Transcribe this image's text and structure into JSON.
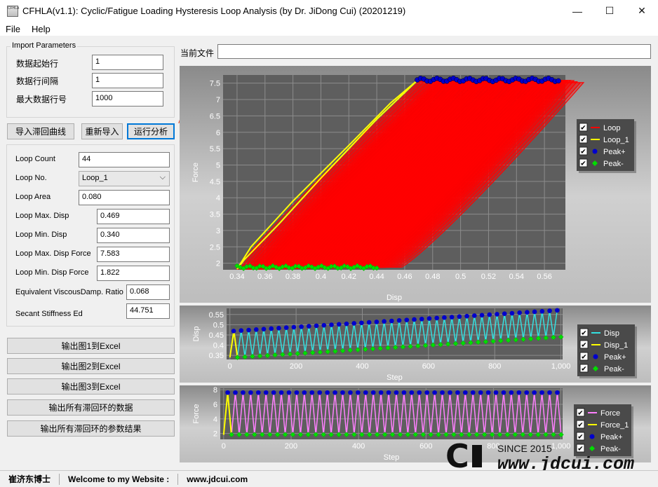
{
  "window": {
    "title": "CFHLA(v1.1): Cyclic/Fatigue Loading Hysteresis Loop Analysis (by Dr. JiDong Cui) (20201219)",
    "icon_label": "CFHLA",
    "minimize_symbol": "—",
    "maximize_symbol": "☐",
    "close_symbol": "✕"
  },
  "menu": {
    "file": "File",
    "help": "Help"
  },
  "import": {
    "legend": "Import Parameters",
    "start_row_label": "数据起始行",
    "start_row_value": "1",
    "row_interval_label": "数据行间隔",
    "row_interval_value": "1",
    "max_row_label": "最大数据行号",
    "max_row_value": "1000"
  },
  "actions": {
    "import_curve": "导入滞回曲线",
    "reimport": "重新导入",
    "run_analysis": "运行分析"
  },
  "results": {
    "loop_count_label": "Loop Count",
    "loop_count_value": "44",
    "loop_no_label": "Loop No.",
    "loop_no_value": "Loop_1",
    "loop_area_label": "Loop Area",
    "loop_area_value": "0.080",
    "max_disp_label": "Loop Max. Disp",
    "max_disp_value": "0.469",
    "min_disp_label": "Loop Min. Disp",
    "min_disp_value": "0.340",
    "max_force_label": "Loop Max. Disp Force",
    "max_force_value": "7.583",
    "min_force_label": "Loop Min. Disp Force",
    "min_force_value": "1.822",
    "damp_label": "Equivalent ViscousDamp. Ratio",
    "damp_value": "0.068",
    "stiff_label": "Secant Stiffness Ed",
    "stiff_value": "44.751"
  },
  "exports": {
    "fig1": "输出图1到Excel",
    "fig2": "输出图2到Excel",
    "fig3": "输出图3到Excel",
    "all_loops": "输出所有滞回环的数据",
    "all_params": "输出所有滞回环的参数结果"
  },
  "current_file": {
    "label": "当前文件",
    "value": ""
  },
  "status": {
    "author": "崔济东博士",
    "welcome": "Welcome to my Website :",
    "site": "www.jdcui.com"
  },
  "watermark": {
    "logo": "C",
    "since": "SINCE 2015",
    "url": "www.jdcui.com"
  },
  "colors": {
    "loop": "#ff0000",
    "loop_1": "#ffff00",
    "peak_plus": "#0000cc",
    "peak_minus": "#00dd00",
    "disp": "#33e0e0",
    "force": "#ff80ff",
    "accent": "#0078d7",
    "arrow": "#e8563a"
  },
  "chart_data": [
    {
      "type": "line",
      "xlabel": "Disp",
      "ylabel": "Force",
      "xticks": [
        "0.34",
        "0.36",
        "0.38",
        "0.4",
        "0.42",
        "0.44",
        "0.46",
        "0.48",
        "0.5",
        "0.52",
        "0.54",
        "0.56"
      ],
      "yticks": [
        "2",
        "2.5",
        "3",
        "3.5",
        "4",
        "4.5",
        "5",
        "5.5",
        "6",
        "6.5",
        "7",
        "7.5"
      ],
      "xlim": [
        0.33,
        0.575
      ],
      "ylim": [
        1.8,
        7.75
      ],
      "legend": [
        "Loop",
        "Loop_1",
        "Peak+",
        "Peak-"
      ],
      "legend_position": "right",
      "series": [
        {
          "name": "Loop",
          "lower_path": [
            [
              0.34,
              1.82
            ],
            [
              0.47,
              7.55
            ]
          ],
          "upper_path": [
            [
              0.44,
              1.9
            ],
            [
              0.57,
              7.6
            ]
          ],
          "loops": 44
        },
        {
          "name": "Loop_1",
          "x": [
            0.34,
            0.35,
            0.38,
            0.42,
            0.45,
            0.469,
            0.469,
            0.44,
            0.4,
            0.37,
            0.345,
            0.34
          ],
          "y": [
            1.822,
            2.5,
            3.9,
            5.6,
            6.9,
            7.583,
            7.583,
            6.4,
            4.6,
            3.2,
            2.1,
            1.822
          ]
        },
        {
          "name": "Peak+",
          "x_range": [
            0.469,
            0.57
          ],
          "y_value": 7.6,
          "count": 44
        },
        {
          "name": "Peak-",
          "x_range": [
            0.34,
            0.44
          ],
          "y_value": 1.88,
          "count": 44
        }
      ]
    },
    {
      "type": "line",
      "xlabel": "Step",
      "ylabel": "Disp",
      "xticks": [
        "0",
        "200",
        "400",
        "600",
        "800",
        "1,000"
      ],
      "yticks": [
        "0.35",
        "0.4",
        "0.45",
        "0.5",
        "0.55"
      ],
      "xlim": [
        -10,
        1005
      ],
      "ylim": [
        0.33,
        0.58
      ],
      "legend": [
        "Disp",
        "Disp_1",
        "Peak+",
        "Peak-"
      ],
      "legend_position": "right",
      "series": [
        {
          "name": "Disp",
          "cycles": 44,
          "peak_start": 0.469,
          "peak_end": 0.57,
          "valley_start": 0.34,
          "valley_end": 0.44
        },
        {
          "name": "Disp_1",
          "x": [
            0,
            12,
            23
          ],
          "y": [
            0.34,
            0.469,
            0.34
          ]
        },
        {
          "name": "Peak+",
          "count": 44
        },
        {
          "name": "Peak-",
          "count": 44
        }
      ]
    },
    {
      "type": "line",
      "xlabel": "Step",
      "ylabel": "Force",
      "xticks": [
        "0",
        "200",
        "400",
        "600",
        "800",
        "1,000"
      ],
      "yticks": [
        "2",
        "4",
        "6",
        "8"
      ],
      "xlim": [
        -10,
        1005
      ],
      "ylim": [
        1.2,
        8.2
      ],
      "legend": [
        "Force",
        "Force_1",
        "Peak+",
        "Peak-"
      ],
      "legend_position": "right",
      "series": [
        {
          "name": "Force",
          "cycles": 44,
          "peak": 7.6,
          "valley": 1.85
        },
        {
          "name": "Force_1",
          "x": [
            0,
            12,
            23
          ],
          "y": [
            1.822,
            7.583,
            1.822
          ]
        },
        {
          "name": "Peak+",
          "count": 44
        },
        {
          "name": "Peak-",
          "count": 44
        }
      ]
    }
  ]
}
